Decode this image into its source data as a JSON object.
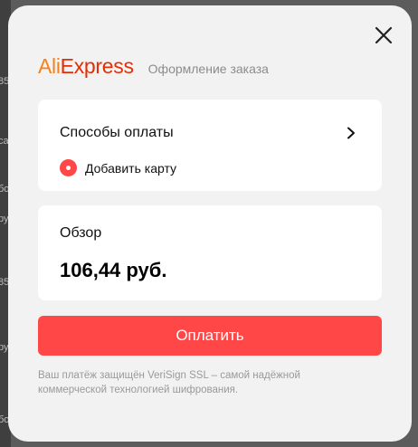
{
  "background": {
    "fragments": [
      "85",
      "са",
      "бо",
      "ру",
      "85",
      "ру",
      "бо"
    ]
  },
  "modal": {
    "close_icon": "close-icon",
    "logo": {
      "part1": "Ali",
      "part2": "Express"
    },
    "subtitle": "Оформление заказа",
    "payment_card": {
      "title": "Способы оплаты",
      "add_card_label": "Добавить карту",
      "chevron_icon": "chevron-right-icon"
    },
    "overview_card": {
      "title": "Обзор",
      "amount": "106,44 руб."
    },
    "pay_button_label": "Оплатить",
    "security_note": "Ваш платёж защищён VeriSign SSL – самой надёжной коммерческой технологией шифрования."
  },
  "colors": {
    "accent": "#ff4747",
    "logo_ali": "#f5821f",
    "logo_express": "#e62e04"
  }
}
